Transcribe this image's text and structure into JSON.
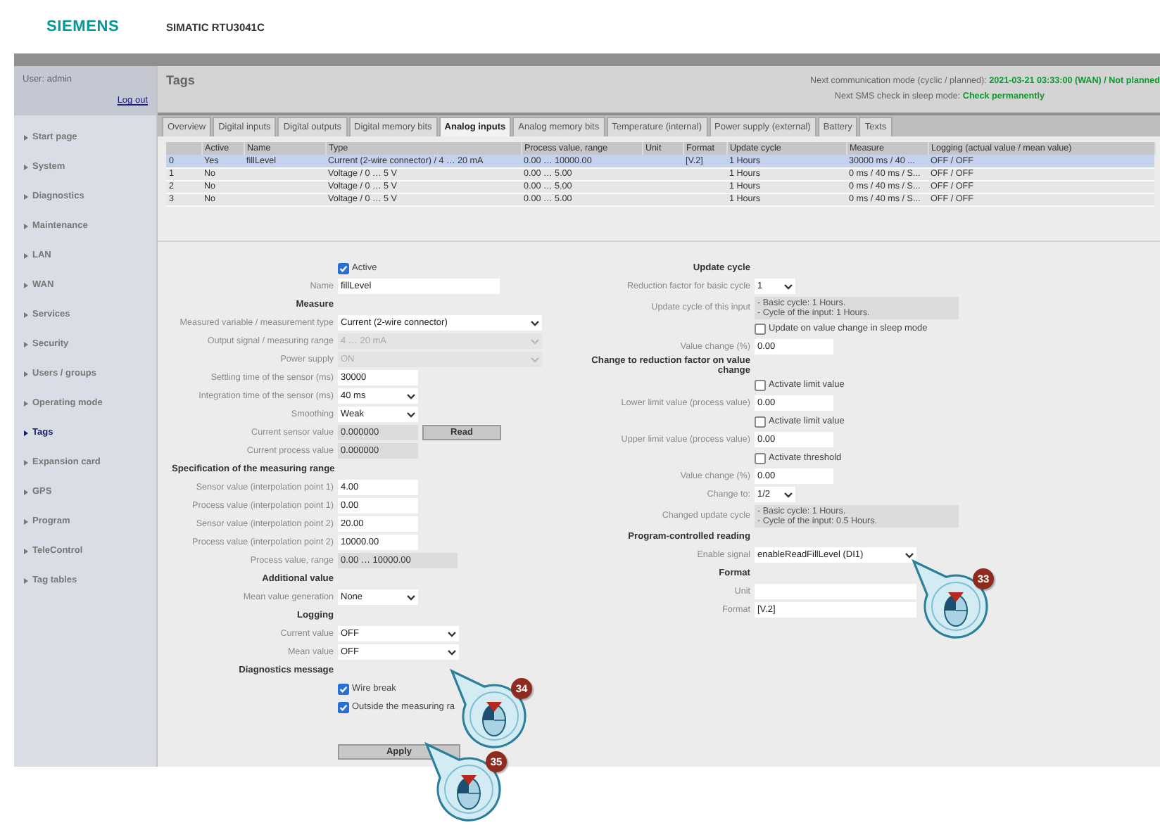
{
  "header": {
    "logo": "SIEMENS",
    "product": "SIMATIC RTU3041C"
  },
  "sidebar": {
    "user": "User: admin",
    "logout": "Log out",
    "items": [
      {
        "label": "Start page",
        "selected": false
      },
      {
        "label": "System",
        "selected": false
      },
      {
        "label": "Diagnostics",
        "selected": false
      },
      {
        "label": "Maintenance",
        "selected": false
      },
      {
        "label": "LAN",
        "selected": false
      },
      {
        "label": "WAN",
        "selected": false
      },
      {
        "label": "Services",
        "selected": false
      },
      {
        "label": "Security",
        "selected": false
      },
      {
        "label": "Users / groups",
        "selected": false
      },
      {
        "label": "Operating mode",
        "selected": false
      },
      {
        "label": "Tags",
        "selected": true
      },
      {
        "label": "Expansion card",
        "selected": false
      },
      {
        "label": "GPS",
        "selected": false
      },
      {
        "label": "Program",
        "selected": false
      },
      {
        "label": "TeleControl",
        "selected": false
      },
      {
        "label": "Tag tables",
        "selected": false
      }
    ]
  },
  "page_title": "Tags",
  "status": [
    {
      "label": "Next communication mode (cyclic / planned):",
      "value": "2021-03-21 03:33:00 (WAN) / Not planned"
    },
    {
      "label": "Next SMS check in sleep mode:",
      "value": "Check permanently"
    }
  ],
  "tabs": [
    {
      "label": "Overview",
      "selected": false
    },
    {
      "label": "Digital inputs",
      "selected": false
    },
    {
      "label": "Digital outputs",
      "selected": false
    },
    {
      "label": "Digital memory bits",
      "selected": false
    },
    {
      "label": "Analog inputs",
      "selected": true
    },
    {
      "label": "Analog memory bits",
      "selected": false
    },
    {
      "label": "Temperature (internal)",
      "selected": false
    },
    {
      "label": "Power supply (external)",
      "selected": false
    },
    {
      "label": "Battery",
      "selected": false
    },
    {
      "label": "Texts",
      "selected": false
    }
  ],
  "table": {
    "columns": [
      null,
      "Active",
      "Name",
      "Type",
      "Process value, range",
      "Unit",
      "Format",
      "Update cycle",
      "Measure",
      "Logging (actual value / mean value)"
    ],
    "rows": [
      {
        "selected": true,
        "cells": [
          "0",
          "Yes",
          "fillLevel",
          "Current (2-wire connector) / 4 … 20 mA",
          "0.00 … 10000.00",
          null,
          "[V.2]",
          "1 Hours",
          "30000 ms / 40 ...",
          "OFF / OFF"
        ]
      },
      {
        "selected": false,
        "cells": [
          "1",
          "No",
          null,
          "Voltage / 0 … 5 V",
          "0.00 … 5.00",
          null,
          null,
          "1 Hours",
          "0 ms / 40 ms / S...",
          "OFF / OFF"
        ]
      },
      {
        "selected": false,
        "cells": [
          "2",
          "No",
          null,
          "Voltage / 0 … 5 V",
          "0.00 … 5.00",
          null,
          null,
          "1 Hours",
          "0 ms / 40 ms / S...",
          "OFF / OFF"
        ]
      },
      {
        "selected": false,
        "cells": [
          "3",
          "No",
          null,
          "Voltage / 0 … 5 V",
          "0.00 … 5.00",
          null,
          null,
          "1 Hours",
          "0 ms / 40 ms / S...",
          "OFF / OFF"
        ]
      }
    ]
  },
  "form_left": [
    {
      "kind": "checkbox",
      "label": "Active",
      "checked": true
    },
    {
      "kind": "text",
      "label": "Name",
      "value": "fillLevel"
    },
    {
      "kind": "heading",
      "label": "Measure"
    },
    {
      "kind": "select",
      "label": "Measured variable / measurement type",
      "value": "Current (2-wire connector)",
      "disabled": false
    },
    {
      "kind": "select",
      "label": "Output signal / measuring range",
      "value": "4 … 20 mA",
      "disabled": true
    },
    {
      "kind": "select",
      "label": "Power supply",
      "value": "ON",
      "disabled": true
    },
    {
      "kind": "text",
      "label": "Settling time of the sensor (ms)",
      "value": "30000"
    },
    {
      "kind": "select",
      "label": "Integration time of the sensor (ms)",
      "value": "40 ms",
      "disabled": false
    },
    {
      "kind": "select",
      "label": "Smoothing",
      "value": "Weak",
      "disabled": false
    },
    {
      "kind": "readonly",
      "label": "Current sensor value",
      "value": "0.000000",
      "button": "Read"
    },
    {
      "kind": "readonly",
      "label": "Current process value",
      "value": "0.000000"
    },
    {
      "kind": "section",
      "label": "Specification of the measuring range"
    },
    {
      "kind": "text",
      "label": "Sensor value (interpolation point 1)",
      "value": "4.00"
    },
    {
      "kind": "text",
      "label": "Process value (interpolation point 1)",
      "value": "0.00"
    },
    {
      "kind": "text",
      "label": "Sensor value (interpolation point 2)",
      "value": "20.00"
    },
    {
      "kind": "text",
      "label": "Process value (interpolation point 2)",
      "value": "10000.00"
    },
    {
      "kind": "readonly",
      "label": "Process value, range",
      "value": "0.00 … 10000.00"
    },
    {
      "kind": "heading",
      "label": "Additional value"
    },
    {
      "kind": "select",
      "label": "Mean value generation",
      "value": "None",
      "disabled": false
    },
    {
      "kind": "heading",
      "label": "Logging"
    },
    {
      "kind": "select",
      "label": "Current value",
      "value": "OFF",
      "disabled": false
    },
    {
      "kind": "select",
      "label": "Mean value",
      "value": "OFF",
      "disabled": false
    },
    {
      "kind": "heading",
      "label": "Diagnostics message"
    },
    {
      "kind": "checkbox",
      "label": "Wire break",
      "checked": true
    },
    {
      "kind": "checkbox",
      "label": "Outside the measuring ra",
      "checked": true
    }
  ],
  "apply_button": "Apply",
  "form_right": [
    {
      "kind": "heading",
      "label": "Update cycle"
    },
    {
      "kind": "select",
      "label": "Reduction factor for basic cycle",
      "value": "1",
      "disabled": false
    },
    {
      "kind": "info",
      "label": "Update cycle of this input",
      "lines": [
        "- Basic cycle: 1 Hours.",
        "- Cycle of the input: 1 Hours."
      ]
    },
    {
      "kind": "checkbox",
      "label": "Update on value change in sleep mode",
      "checked": false
    },
    {
      "kind": "text",
      "label": "Value change (%)",
      "value": "0.00"
    },
    {
      "kind": "heading",
      "label": "Change to reduction factor on value change"
    },
    {
      "kind": "checkbox",
      "label": "Activate limit value",
      "checked": false
    },
    {
      "kind": "text",
      "label": "Lower limit value (process value)",
      "value": "0.00"
    },
    {
      "kind": "checkbox",
      "label": "Activate limit value",
      "checked": false
    },
    {
      "kind": "text",
      "label": "Upper limit value (process value)",
      "value": "0.00"
    },
    {
      "kind": "checkbox",
      "label": "Activate threshold",
      "checked": false
    },
    {
      "kind": "text",
      "label": "Value change (%)",
      "value": "0.00"
    },
    {
      "kind": "select",
      "label": "Change to:",
      "value": "1/2",
      "disabled": false
    },
    {
      "kind": "info",
      "label": "Changed update cycle",
      "lines": [
        "- Basic cycle: 1 Hours.",
        "- Cycle of the input: 0.5 Hours."
      ]
    },
    {
      "kind": "heading",
      "label": "Program-controlled reading"
    },
    {
      "kind": "select",
      "label": "Enable signal",
      "value": "enableReadFillLevel (DI1)",
      "disabled": false
    },
    {
      "kind": "heading",
      "label": "Format"
    },
    {
      "kind": "text",
      "label": "Unit"
    },
    {
      "kind": "text",
      "label": "Format",
      "value": "[V.2]"
    }
  ],
  "callouts": [
    {
      "number": "33"
    },
    {
      "number": "34"
    },
    {
      "number": "35"
    }
  ]
}
